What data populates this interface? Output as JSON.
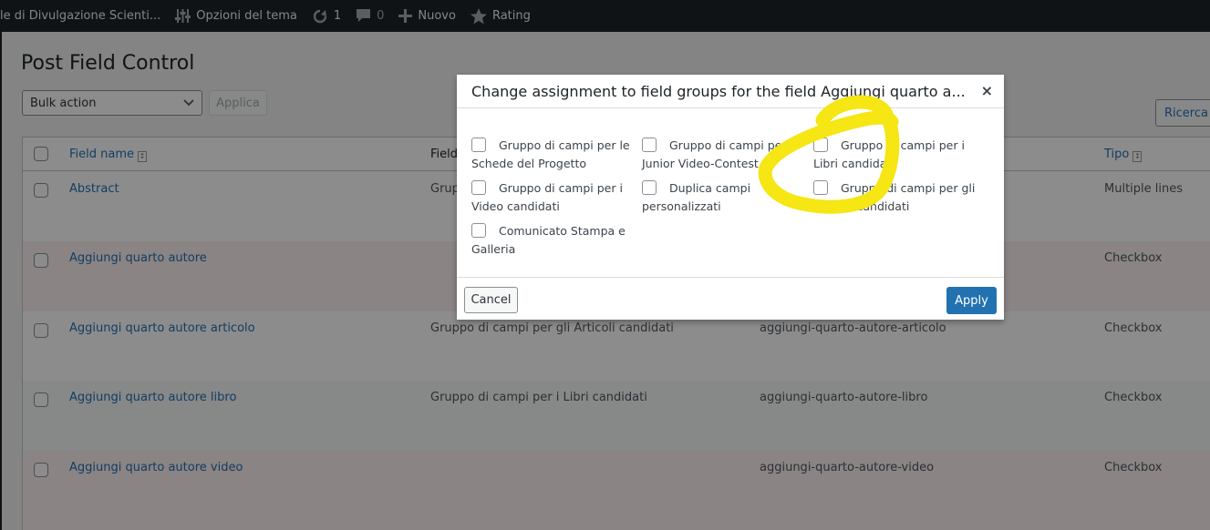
{
  "adminbar": {
    "site_name": "le di Divulgazione Scienti...",
    "theme_options": "Opzioni del tema",
    "updates_count": "1",
    "comments_count": "0",
    "new_label": "Nuovo",
    "rating_label": "Rating"
  },
  "page": {
    "title": "Post Field Control",
    "bulk_action": "Bulk action",
    "apply_label": "Applica",
    "search_label": "Ricerca"
  },
  "table": {
    "columns": {
      "name": "Field name",
      "group": "Field",
      "type": "Tipo"
    },
    "rows": [
      {
        "name": "Abstract",
        "group": "Grupp",
        "slug": "",
        "type": "Multiple lines"
      },
      {
        "name": "Aggiungi quarto autore",
        "group": "",
        "slug": "",
        "type": "Checkbox"
      },
      {
        "name": "Aggiungi quarto autore articolo",
        "group": "Gruppo di campi per gli Articoli candidati",
        "slug": "aggiungi-quarto-autore-articolo",
        "type": "Checkbox"
      },
      {
        "name": "Aggiungi quarto autore libro",
        "group": "Gruppo di campi per i Libri candidati",
        "slug": "aggiungi-quarto-autore-libro",
        "type": "Checkbox"
      },
      {
        "name": "Aggiungi quarto autore video",
        "group": "",
        "slug": "aggiungi-quarto-autore-video",
        "type": "Checkbox"
      }
    ]
  },
  "dialog": {
    "title": "Change assignment to field groups for the field Aggiungi quarto a...",
    "close": "×",
    "options": [
      "Gruppo di campi per le Schede del Progetto",
      "Gruppo di campi per Junior Video-Contest",
      "Gruppo di campi per i Libri candidati",
      "Gruppo di campi per i Video candidati",
      "Duplica campi personalizzati",
      "Gruppo di campi per gli Articoli candidati",
      "Comunicato Stampa e Galleria"
    ],
    "cancel_label": "Cancel",
    "apply_label": "Apply"
  },
  "annotation": {
    "color": "#f5e614"
  },
  "colors": {
    "accent": "#2271b1",
    "adminbar": "#1d2327"
  }
}
